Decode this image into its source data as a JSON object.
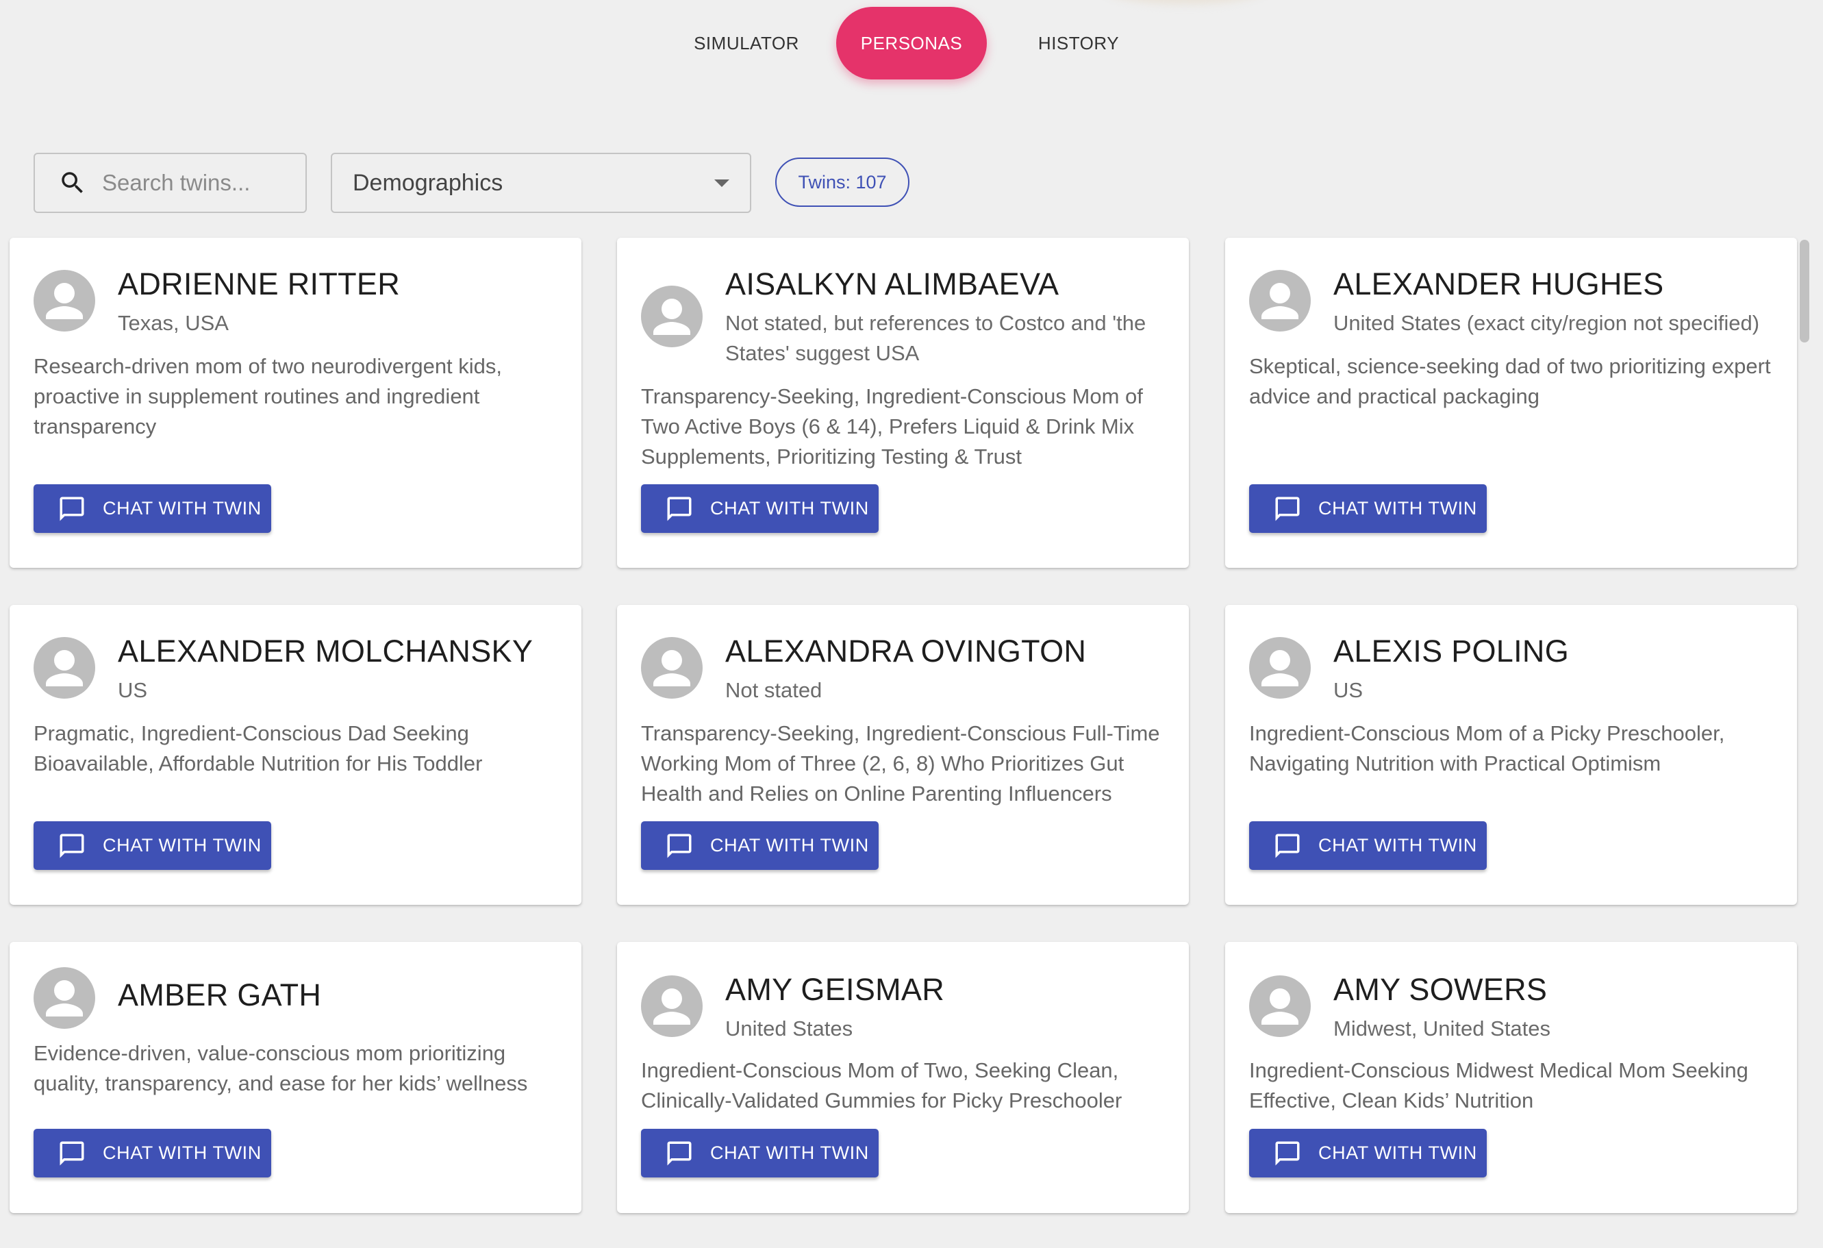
{
  "nav": {
    "tabs": [
      {
        "label": "SIMULATOR"
      },
      {
        "label": "PERSONAS",
        "active": true
      },
      {
        "label": "HISTORY"
      }
    ]
  },
  "toolbar": {
    "search_placeholder": "Search twins...",
    "filter_value": "Demographics",
    "count_label": "Twins: 107"
  },
  "colors": {
    "accent": "#e5336a",
    "primary": "#3f51b5",
    "background": "#efefef"
  },
  "cards": [
    {
      "name": "ADRIENNE RITTER",
      "location": "Texas, USA",
      "description": "Research-driven mom of two neurodivergent kids, proactive in supplement routines and ingredient transparency",
      "button": "CHAT WITH TWIN"
    },
    {
      "name": "AISALKYN ALIMBAEVA",
      "location": "Not stated, but references to Costco and 'the States' suggest USA",
      "description": "Transparency-Seeking, Ingredient-Conscious Mom of Two Active Boys (6 & 14), Prefers Liquid & Drink Mix Supplements, Prioritizing Testing & Trust",
      "button": "CHAT WITH TWIN"
    },
    {
      "name": "ALEXANDER HUGHES",
      "location": "United States (exact city/region not specified)",
      "description": "Skeptical, science-seeking dad of two prioritizing expert advice and practical packaging",
      "button": "CHAT WITH TWIN"
    },
    {
      "name": "ALEXANDER MOLCHANSKY",
      "location": "US",
      "description": "Pragmatic, Ingredient-Conscious Dad Seeking Bioavailable, Affordable Nutrition for His Toddler",
      "button": "CHAT WITH TWIN"
    },
    {
      "name": "ALEXANDRA OVINGTON",
      "location": "Not stated",
      "description": "Transparency-Seeking, Ingredient-Conscious Full-Time Working Mom of Three (2, 6, 8) Who Prioritizes Gut Health and Relies on Online Parenting Influencers",
      "button": "CHAT WITH TWIN"
    },
    {
      "name": "ALEXIS POLING",
      "location": "US",
      "description": "Ingredient-Conscious Mom of a Picky Preschooler, Navigating Nutrition with Practical Optimism",
      "button": "CHAT WITH TWIN"
    },
    {
      "name": "AMBER GATH",
      "location": "",
      "description": "Evidence-driven, value-conscious mom prioritizing quality, transparency, and ease for her kids’ wellness",
      "button": "CHAT WITH TWIN"
    },
    {
      "name": "AMY GEISMAR",
      "location": "United States",
      "description": "Ingredient-Conscious Mom of Two, Seeking Clean, Clinically-Validated Gummies for Picky Preschooler",
      "button": "CHAT WITH TWIN"
    },
    {
      "name": "AMY SOWERS",
      "location": "Midwest, United States",
      "description": "Ingredient-Conscious Midwest Medical Mom Seeking Effective, Clean Kids’ Nutrition",
      "button": "CHAT WITH TWIN"
    }
  ]
}
